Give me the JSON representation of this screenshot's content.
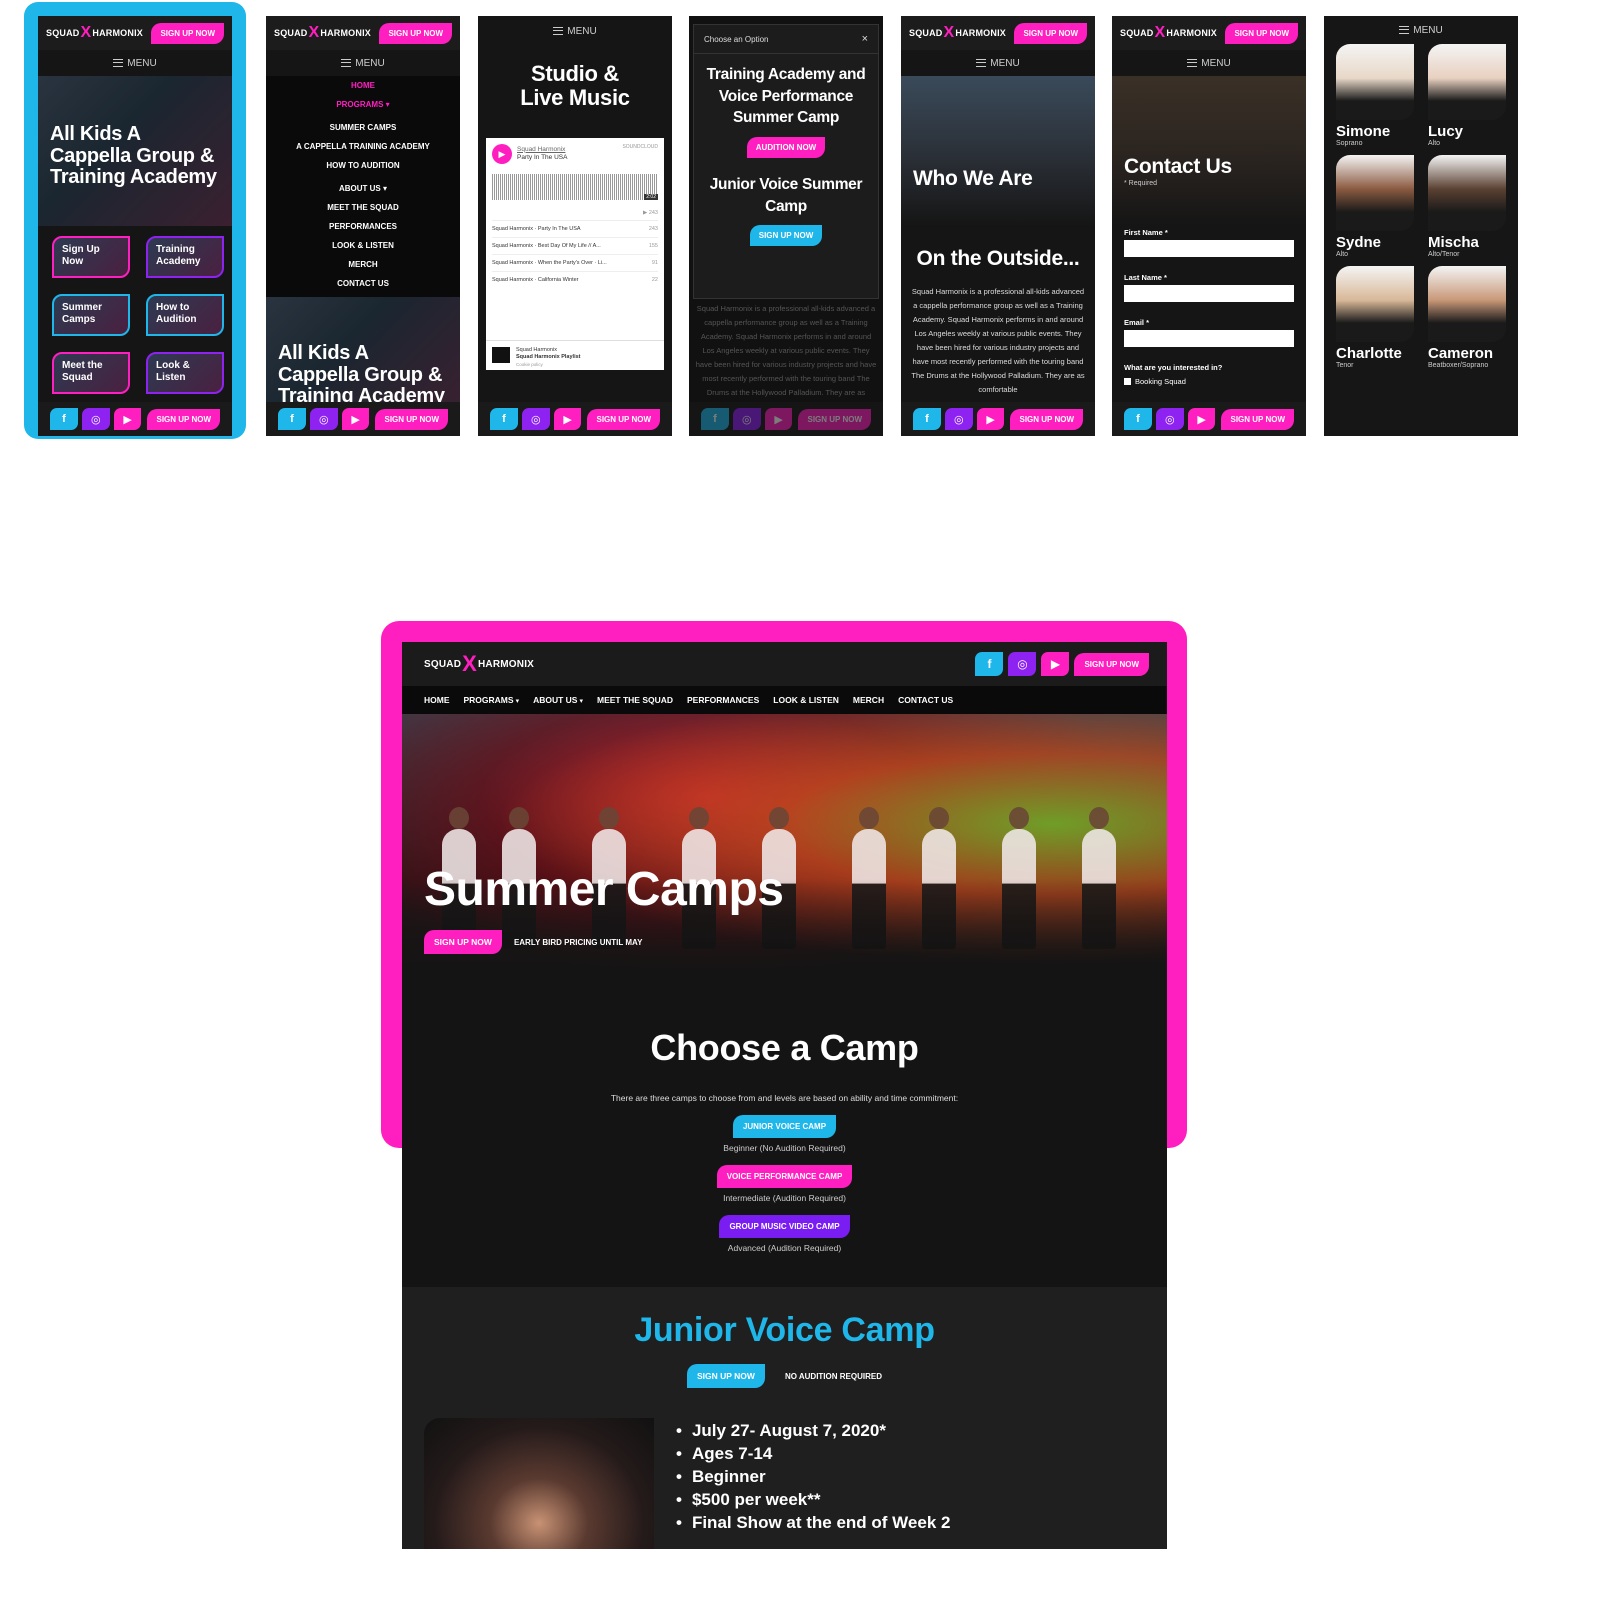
{
  "brand": {
    "logo_left": "SQUAD",
    "logo_x": "X",
    "logo_right": "HARMONIX",
    "accent": "#ff1fc0",
    "cyan": "#1fb6ea",
    "purple": "#8e22f0"
  },
  "common": {
    "signup": "SIGN UP NOW",
    "menu": "MENU",
    "fb": "f",
    "ig": "◎",
    "yt": "▶"
  },
  "phone1": {
    "hero": "All Kids A Cappella Group & Training Academy",
    "tiles": [
      {
        "label": "Sign Up Now"
      },
      {
        "label": "Training Academy"
      },
      {
        "label": "Summer Camps"
      },
      {
        "label": "How to Audition"
      },
      {
        "label": "Meet the Squad"
      },
      {
        "label": "Look & Listen"
      }
    ]
  },
  "phone2": {
    "menu_items": [
      "HOME",
      "PROGRAMS",
      "SUMMER CAMPS",
      "A CAPPELLA TRAINING ACADEMY",
      "HOW TO AUDITION",
      "ABOUT US",
      "MEET THE SQUAD",
      "PERFORMANCES",
      "LOOK & LISTEN",
      "MERCH",
      "CONTACT US"
    ],
    "hero": "All Kids A Cappella Group & Training Academy"
  },
  "phone3": {
    "title": "Studio & Live Music",
    "player_artist": "Squad Harmonix",
    "player_track": "Party In The USA",
    "player_brand": "SOUNDCLOUD",
    "player_time": "2:02",
    "tracks": [
      {
        "title": "Squad Harmonix · Party In The USA",
        "plays": "243"
      },
      {
        "title": "Squad Harmonix · Best Day Of My Life // A...",
        "plays": "155"
      },
      {
        "title": "Squad Harmonix · When the Party's Over · Li...",
        "plays": "91"
      },
      {
        "title": "Squad Harmonix · California Winter",
        "plays": "22"
      }
    ],
    "top_plays": "243",
    "footer_artist": "Squad Harmonix",
    "footer_playlist": "Squad Harmonix Playlist",
    "cookie": "Cookie policy"
  },
  "phone4": {
    "modal_title": "Choose an Option",
    "close": "×",
    "opt1": "Training Academy and Voice Performance Summer Camp",
    "opt1_btn": "AUDITION NOW",
    "opt2": "Junior Voice Summer Camp",
    "opt2_btn": "SIGN UP NOW",
    "body": "Squad Harmonix is a professional all-kids advanced a cappella performance group as well as a Training Academy. Squad Harmonix performs in and around Los Angeles weekly at various public events. They have been hired for various industry projects and have most recently performed with the touring band The Drums at the Hollywood Palladium. They are as comfortable"
  },
  "phone5": {
    "hero": "Who We Are",
    "title": "On the Outside...",
    "body": "Squad Harmonix is a professional all-kids advanced a cappella performance group as well as a Training Academy. Squad Harmonix performs in and around Los Angeles weekly at various public events. They have been hired for various industry projects and have most recently performed with the touring band The Drums at the Hollywood Palladium. They are as comfortable"
  },
  "phone6": {
    "title": "Contact Us",
    "required": "* Required",
    "first": "First Name *",
    "last": "Last Name *",
    "email": "Email *",
    "interest": "What are you interested in?",
    "opt": "Booking Squad"
  },
  "phone7": {
    "members": [
      {
        "name": "Simone",
        "role": "Soprano"
      },
      {
        "name": "Lucy",
        "role": "Alto"
      },
      {
        "name": "Sydne",
        "role": "Alto"
      },
      {
        "name": "Mischa",
        "role": "Alto/Tenor"
      },
      {
        "name": "Charlotte",
        "role": "Tenor"
      },
      {
        "name": "Cameron",
        "role": "Beatboxer/Soprano"
      }
    ]
  },
  "desktop": {
    "nav": [
      "HOME",
      "PROGRAMS",
      "ABOUT US",
      "MEET THE SQUAD",
      "PERFORMANCES",
      "LOOK & LISTEN",
      "MERCH",
      "CONTACT US"
    ],
    "caret": "▾",
    "hero_title": "Summer Camps",
    "hero_cta": "SIGN UP NOW",
    "hero_note": "EARLY BIRD PRICING UNTIL MAY",
    "choose_title": "Choose a Camp",
    "choose_sub": "There are three camps to choose from and levels are based on ability and time commitment:",
    "camps": [
      {
        "label": "JUNIOR VOICE CAMP",
        "caption": "Beginner (No Audition Required)"
      },
      {
        "label": "VOICE PERFORMANCE CAMP",
        "caption": "Intermediate (Audition Required)"
      },
      {
        "label": "GROUP MUSIC VIDEO CAMP",
        "caption": "Advanced (Audition Required)"
      }
    ],
    "junior_title": "Junior Voice Camp",
    "junior_cta": "SIGN UP NOW",
    "junior_note": "NO AUDITION REQUIRED",
    "junior_list": [
      "July 27- August 7, 2020*",
      "Ages 7-14",
      "Beginner",
      "$500 per week**",
      "Final Show at the end of Week 2"
    ]
  }
}
